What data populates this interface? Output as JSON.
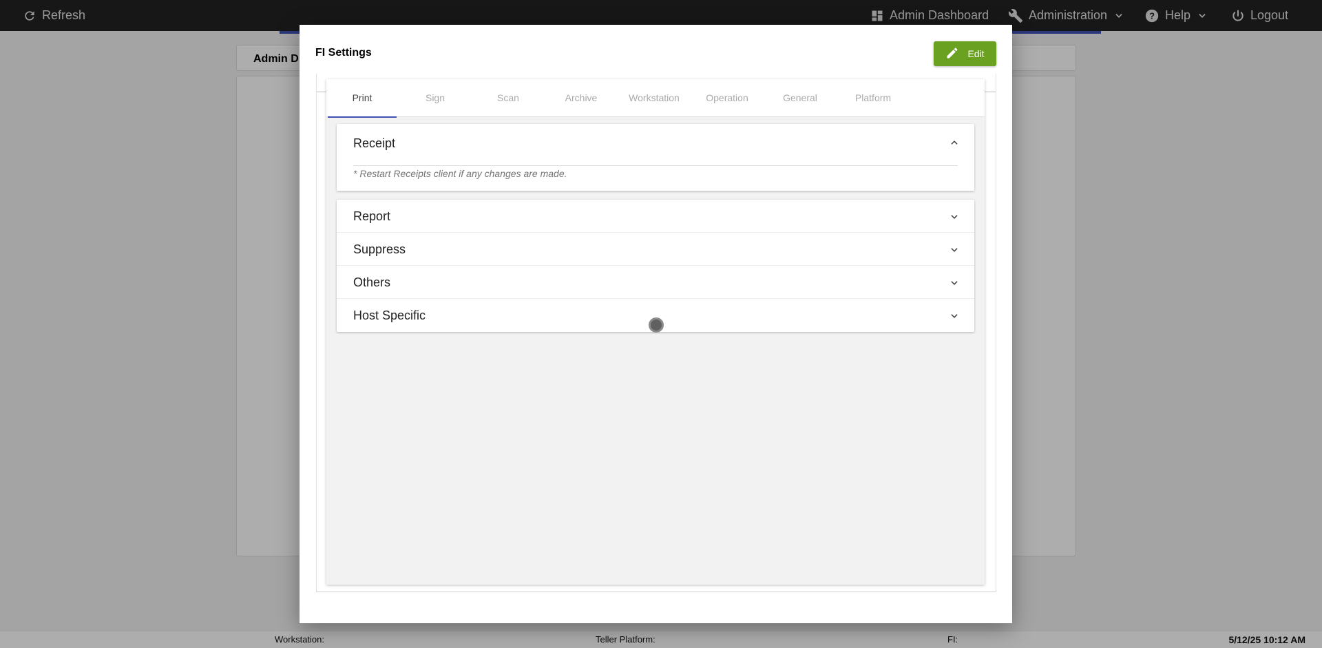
{
  "topbar": {
    "refresh_label": "Refresh",
    "admin_dashboard_label": "Admin Dashboard",
    "administration_label": "Administration",
    "help_label": "Help",
    "logout_label": "Logout"
  },
  "background": {
    "card_title": "Admin D"
  },
  "statusbar": {
    "workstation_label": "Workstation:",
    "teller_platform_label": "Teller Platform:",
    "fi_label": "FI:",
    "datetime": "5/12/25 10:12 AM"
  },
  "modal": {
    "title": "FI Settings",
    "edit_label": "Edit",
    "tabs": [
      {
        "label": "Print",
        "active": true
      },
      {
        "label": "Sign",
        "active": false
      },
      {
        "label": "Scan",
        "active": false
      },
      {
        "label": "Archive",
        "active": false
      },
      {
        "label": "Workstation",
        "active": false
      },
      {
        "label": "Operation",
        "active": false
      },
      {
        "label": "General",
        "active": false
      },
      {
        "label": "Platform",
        "active": false
      }
    ],
    "receipt": {
      "title": "Receipt",
      "note": "* Restart Receipts client if any changes are made."
    },
    "sections": [
      {
        "label": "Report"
      },
      {
        "label": "Suppress"
      },
      {
        "label": "Others"
      },
      {
        "label": "Host Specific"
      }
    ]
  },
  "colors": {
    "topbar_bg": "#222222",
    "accent_blue": "#3f51b5",
    "edit_green": "#6aa121"
  },
  "icons": {
    "refresh": "refresh-icon",
    "dashboard": "dashboard-icon",
    "administration": "wrench-icon",
    "help": "help-circle-icon",
    "logout": "power-icon",
    "edit": "pencil-icon",
    "expand": "chevron-down-icon",
    "collapse": "chevron-up-icon"
  }
}
